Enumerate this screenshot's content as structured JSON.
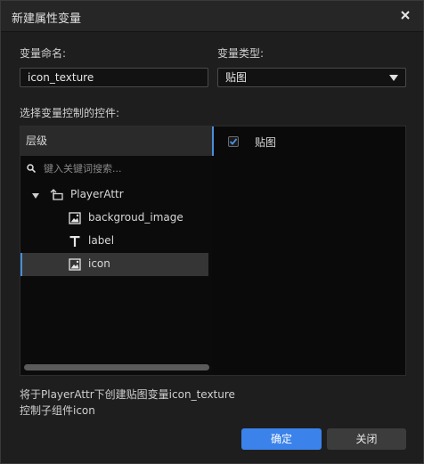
{
  "dialog": {
    "title": "新建属性变量"
  },
  "form": {
    "name_label": "变量命名:",
    "name_value": "icon_texture",
    "type_label": "变量类型:",
    "type_value": "贴图",
    "controls_label": "选择变量控制的控件:"
  },
  "tree": {
    "header": "层级",
    "search_placeholder": "键入关键词搜索...",
    "root": {
      "label": "PlayerAttr",
      "expanded": true
    },
    "children": [
      {
        "label": "backgroud_image",
        "icon": "image-icon",
        "selected": false
      },
      {
        "label": "label",
        "icon": "text-icon",
        "selected": false
      },
      {
        "label": "icon",
        "icon": "image-icon",
        "selected": true
      }
    ]
  },
  "properties": [
    {
      "label": "贴图",
      "checked": true
    }
  ],
  "info": {
    "line1": "将于PlayerAttr下创建贴图变量icon_texture",
    "line2": "控制子组件icon"
  },
  "buttons": {
    "ok": "确定",
    "cancel": "关闭"
  },
  "colors": {
    "accent": "#3b82ea",
    "selection": "#353535"
  }
}
